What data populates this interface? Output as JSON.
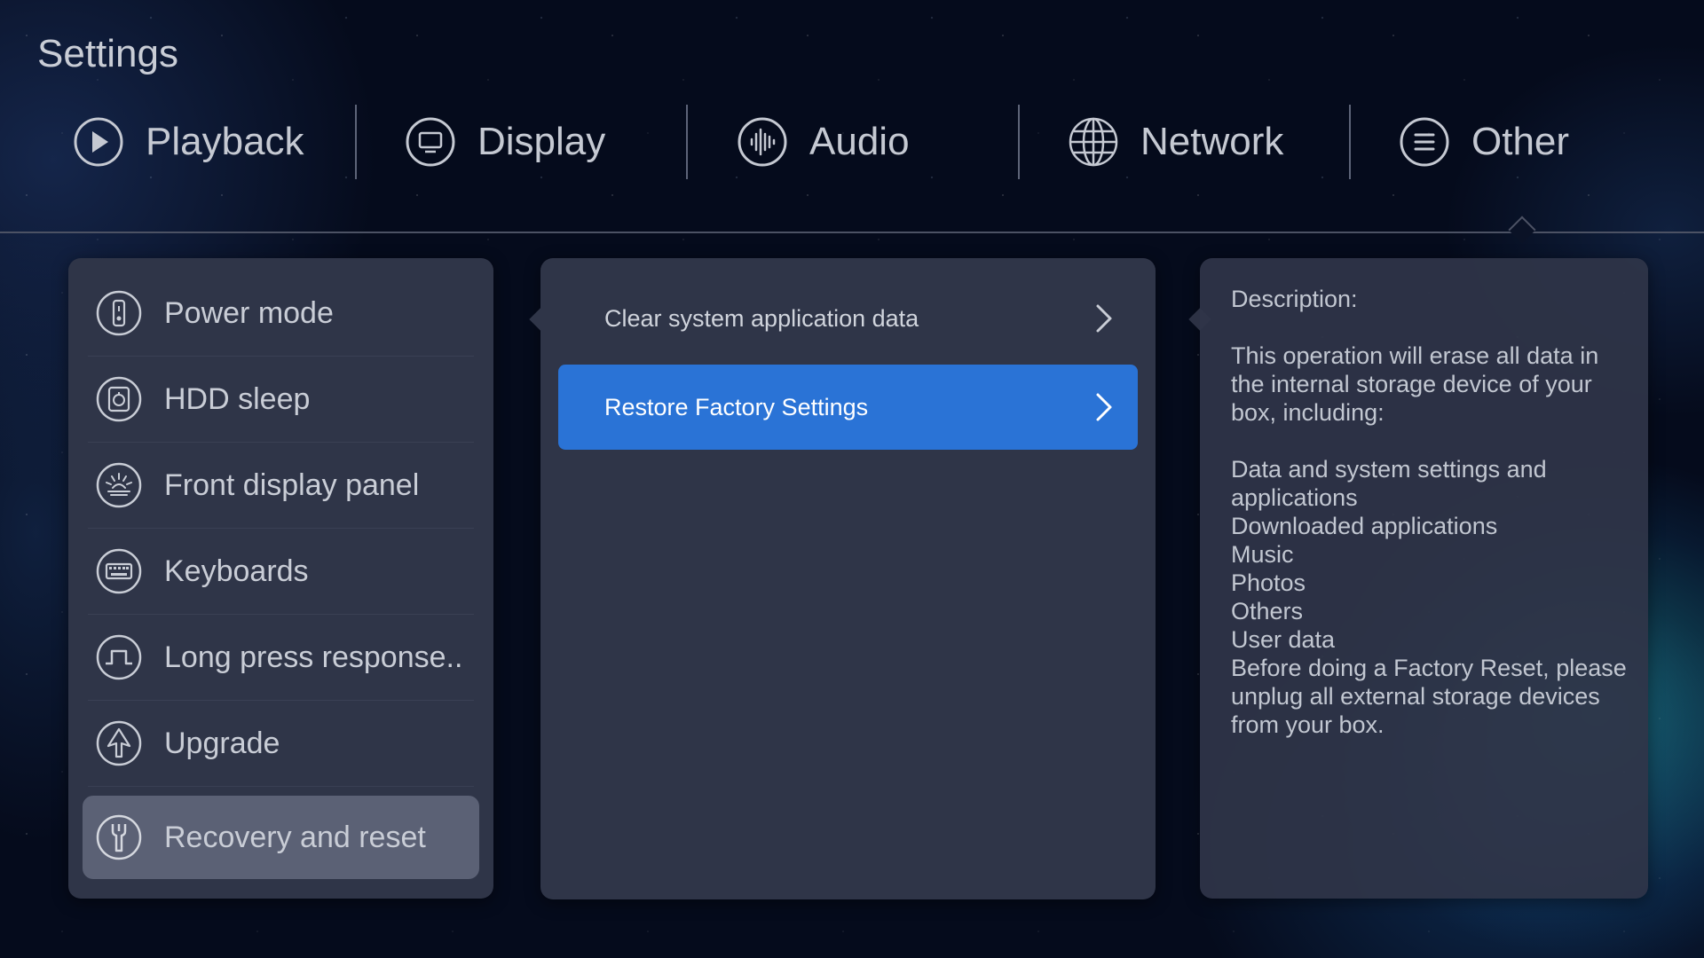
{
  "window": {
    "title": "Settings"
  },
  "tabs": [
    {
      "label": "Playback",
      "icon": "play-circle-icon"
    },
    {
      "label": "Display",
      "icon": "monitor-icon"
    },
    {
      "label": "Audio",
      "icon": "audio-wave-icon"
    },
    {
      "label": "Network",
      "icon": "globe-icon"
    },
    {
      "label": "Other",
      "icon": "menu-lines-icon",
      "selected": true
    }
  ],
  "sidebar": {
    "items": [
      {
        "label": "Power mode",
        "icon": "power-remote-icon"
      },
      {
        "label": "HDD sleep",
        "icon": "hdd-timer-icon"
      },
      {
        "label": "Front display panel",
        "icon": "front-panel-icon"
      },
      {
        "label": "Keyboards",
        "icon": "keyboard-icon"
      },
      {
        "label": "Long press response..",
        "icon": "pulse-square-icon"
      },
      {
        "label": "Upgrade",
        "icon": "upgrade-arrow-icon"
      },
      {
        "label": "Recovery and reset",
        "icon": "wrench-icon",
        "selected": true
      }
    ]
  },
  "options": {
    "items": [
      {
        "label": "Clear system application data",
        "active": false
      },
      {
        "label": "Restore Factory Settings",
        "active": true
      }
    ]
  },
  "description": {
    "heading": "Description:",
    "intro": "This operation will erase all data in the internal storage device of your box, including:",
    "list": [
      "Data and system settings and applications",
      "Downloaded applications",
      "Music",
      "Photos",
      "Others",
      "User data"
    ],
    "warning": "Before doing a Factory Reset, please unplug all external storage devices from your box."
  },
  "colors": {
    "background": "#050b1c",
    "panel": "#2f3548",
    "accent_blue": "#2a73d6",
    "selected_item": "#5b6175"
  }
}
